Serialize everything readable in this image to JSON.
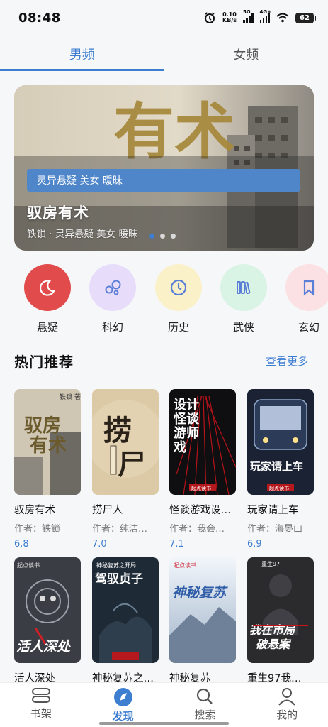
{
  "status": {
    "time": "08:48",
    "speed_value": "0.10",
    "speed_unit": "KB/s",
    "net1": "5G",
    "net2": "4G+",
    "battery": "62"
  },
  "tabs": [
    {
      "label": "男频",
      "active": true
    },
    {
      "label": "女频",
      "active": false
    }
  ],
  "banner": {
    "tags": "灵异悬疑  美女  暖昧",
    "title": "驭房有术",
    "subtitle": "铁锁 · 灵异悬疑  美女  暖昧",
    "cover_text": "有术",
    "pages": 3,
    "current_page": 1
  },
  "categories": [
    {
      "label": "悬疑",
      "icon": "moon-icon",
      "bg": "#e24b4b"
    },
    {
      "label": "科幻",
      "icon": "bubbles-icon",
      "bg": "#e7dcfa"
    },
    {
      "label": "历史",
      "icon": "clock-icon",
      "bg": "#fbf1c9"
    },
    {
      "label": "武侠",
      "icon": "books-icon",
      "bg": "#d9f3e4"
    },
    {
      "label": "玄幻",
      "icon": "bookmark-icon",
      "bg": "#fbe1e3"
    }
  ],
  "section": {
    "title": "热门推荐",
    "more": "查看更多"
  },
  "books": [
    {
      "title": "驭房有术",
      "author": "作者：铁锁",
      "score": "6.8",
      "cover_text": "驭房有术",
      "cover_corner": "铁锁 著"
    },
    {
      "title": "捞尸人",
      "author": "作者：纯洁…",
      "score": "7.0",
      "cover_text": "捞尸人",
      "cover_corner": ""
    },
    {
      "title": "怪谈游戏设…",
      "author": "作者：我会…",
      "score": "7.1",
      "cover_text": "怪谈游戏设计师",
      "cover_corner": "起点读书"
    },
    {
      "title": "玩家请上车",
      "author": "作者：海晏山",
      "score": "6.9",
      "cover_text": "玩家请上车",
      "cover_corner": "起点读书"
    },
    {
      "title": "活人深处",
      "author": "",
      "score": "",
      "cover_text": "活人深处",
      "cover_corner": "起点读书"
    },
    {
      "title": "神秘复苏之…",
      "author": "",
      "score": "",
      "cover_text": "驾驭贞子",
      "cover_corner": "神秘复苏之开局"
    },
    {
      "title": "神秘复苏",
      "author": "",
      "score": "",
      "cover_text": "神秘复苏",
      "cover_corner": "起点读书"
    },
    {
      "title": "重生97我…",
      "author": "",
      "score": "",
      "cover_text": "我在市局破悬案",
      "cover_corner": "重生97"
    }
  ],
  "nav": [
    {
      "label": "书架",
      "icon": "bookshelf-icon",
      "active": false
    },
    {
      "label": "发现",
      "icon": "compass-icon",
      "active": true
    },
    {
      "label": "搜索",
      "icon": "search-icon",
      "active": false
    },
    {
      "label": "我的",
      "icon": "profile-icon",
      "active": false
    }
  ],
  "colors": {
    "accent": "#3d7ed1",
    "banner_tag": "#4f86c9"
  }
}
